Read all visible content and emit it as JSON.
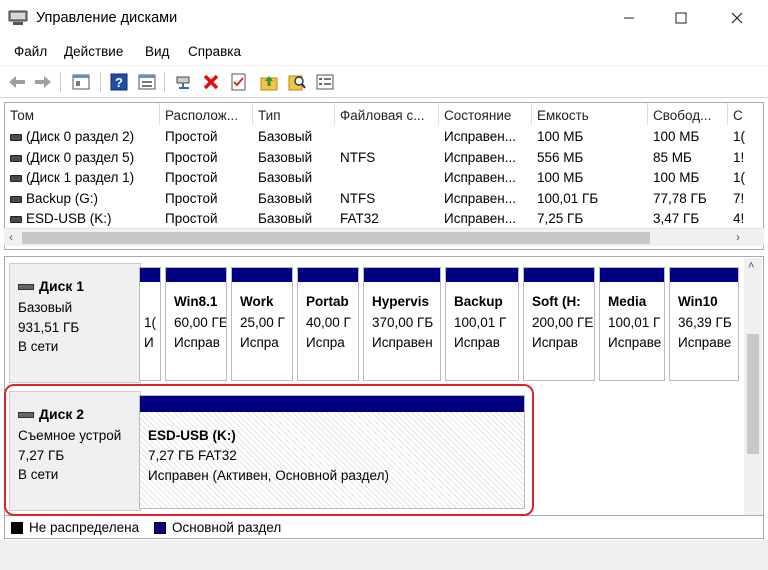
{
  "window": {
    "title": "Управление дисками"
  },
  "menu": [
    "Файл",
    "Действие",
    "Вид",
    "Справка"
  ],
  "toolbar": {
    "icons": [
      "back-arrow-icon",
      "forward-arrow-icon",
      "properties-icon",
      "help-icon",
      "view-icon",
      "connect-icon",
      "delete-icon",
      "check-icon",
      "folder-up-icon",
      "search-icon",
      "list-icon"
    ]
  },
  "volumes": {
    "columns": [
      "Том",
      "Располож...",
      "Тип",
      "Файловая с...",
      "Состояние",
      "Емкость",
      "Свобод...",
      "С"
    ],
    "rows": [
      [
        "(Диск 0 раздел 2)",
        "Простой",
        "Базовый",
        "",
        "Исправен...",
        "100 МБ",
        "100 МБ",
        "1("
      ],
      [
        "(Диск 0 раздел 5)",
        "Простой",
        "Базовый",
        "NTFS",
        "Исправен...",
        "556 МБ",
        "85 МБ",
        "1!"
      ],
      [
        "(Диск 1 раздел 1)",
        "Простой",
        "Базовый",
        "",
        "Исправен...",
        "100 МБ",
        "100 МБ",
        "1("
      ],
      [
        "Backup (G:)",
        "Простой",
        "Базовый",
        "NTFS",
        "Исправен...",
        "100,01 ГБ",
        "77,78 ГБ",
        "7!"
      ],
      [
        "ESD-USB (K:)",
        "Простой",
        "Базовый",
        "FAT32",
        "Исправен...",
        "7,25 ГБ",
        "3,47 ГБ",
        "4!"
      ]
    ]
  },
  "disks": [
    {
      "name": "Диск 1",
      "type": "Базовый",
      "size": "931,51 ГБ",
      "status": "В сети",
      "partitions": [
        {
          "name": "",
          "size": "1(",
          "state": "И"
        },
        {
          "name": "Win8.1",
          "size": "60,00 ГЕ",
          "state": "Исправ"
        },
        {
          "name": "Work",
          "size": "25,00 Г",
          "state": "Испра"
        },
        {
          "name": "Portab",
          "size": "40,00 Г",
          "state": "Испра"
        },
        {
          "name": "Hypervis",
          "size": "370,00 ГБ",
          "state": "Исправен"
        },
        {
          "name": "Backup",
          "size": "100,01 Г",
          "state": "Исправ"
        },
        {
          "name": "Soft  (H:",
          "size": "200,00 ГЕ",
          "state": "Исправ"
        },
        {
          "name": "Media",
          "size": "100,01 Г",
          "state": "Исправе"
        },
        {
          "name": "Win10",
          "size": "36,39 ГБ",
          "state": "Исправе"
        }
      ]
    },
    {
      "name": "Диск 2",
      "type": "Съемное устрой",
      "size": "7,27 ГБ",
      "status": "В сети",
      "partitions": [
        {
          "name": "ESD-USB  (K:)",
          "size": "7,27 ГБ FAT32",
          "state": "Исправен (Активен, Основной раздел)"
        }
      ]
    }
  ],
  "legend": [
    {
      "label": "Не распределена",
      "color": "#000000"
    },
    {
      "label": "Основной раздел",
      "color": "#000080"
    }
  ],
  "colors": {
    "primary_partition": "#000080",
    "highlight": "#e0242b"
  }
}
